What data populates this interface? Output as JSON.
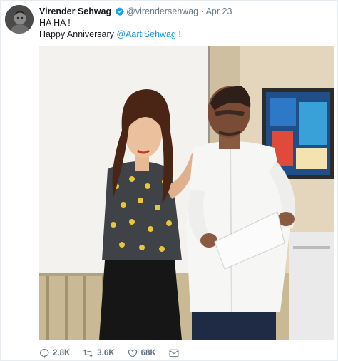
{
  "tweet": {
    "author_name": "Virender Sehwag",
    "handle": "@virendersehwag",
    "separator": "·",
    "date": "Apr 23",
    "line1": "HA HA !",
    "line2_prefix": "Happy Anniversary ",
    "line2_mention": "@AartiSehwag",
    "line2_suffix": " !"
  },
  "actions": {
    "replies": "2.8K",
    "retweets": "3.6K",
    "likes": "68K"
  },
  "colors": {
    "link": "#1b95e0",
    "verified": "#1da1f2",
    "muted": "#657786"
  },
  "icons": [
    "avatar",
    "verified-badge-icon",
    "reply-icon",
    "retweet-icon",
    "like-icon",
    "direct-message-icon"
  ]
}
